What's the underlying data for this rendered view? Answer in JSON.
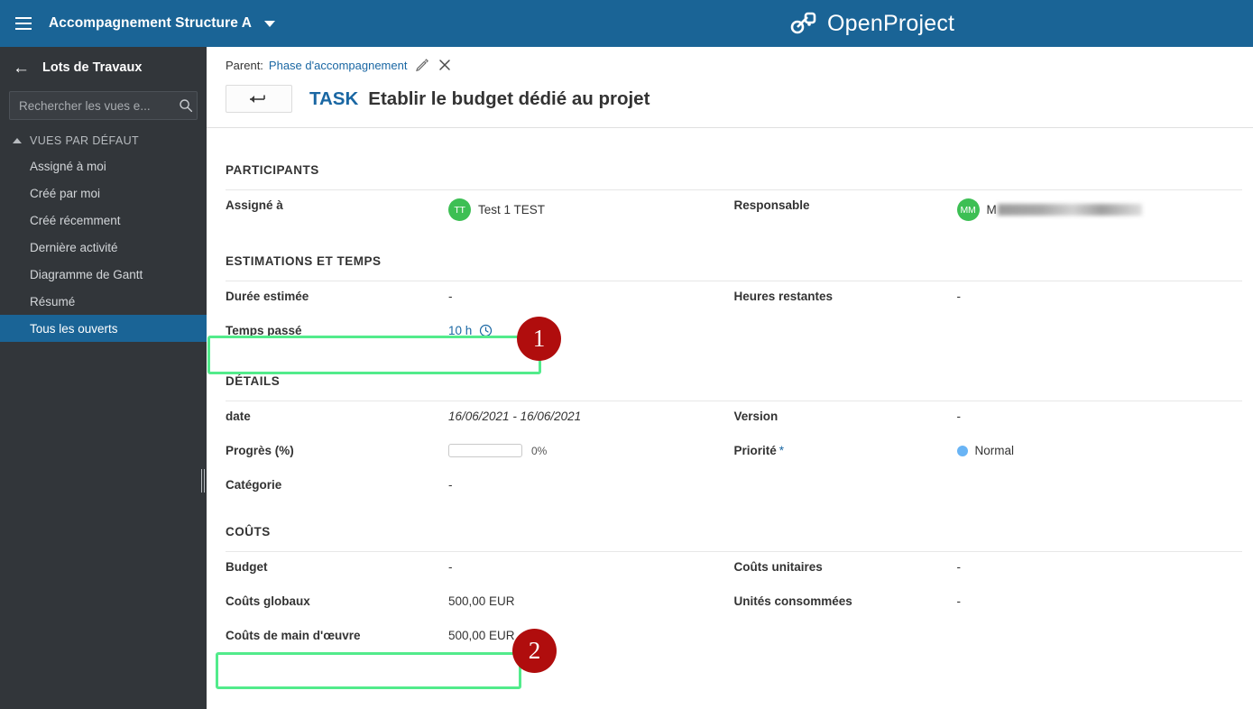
{
  "topbar": {
    "menu_icon": "hamburger-icon",
    "project_name": "Accompagnement Structure A",
    "dropdown_icon": "chevron-down-icon",
    "brand_name": "OpenProject",
    "brand_color": "#1a6496"
  },
  "sidebar": {
    "back_icon": "arrow-left-icon",
    "title": "Lots de Travaux",
    "search": {
      "value": "",
      "placeholder": "Rechercher les vues e...",
      "icon": "search-icon"
    },
    "group_label": "VUES PAR DÉFAUT",
    "group_caret_icon": "chevron-up-icon",
    "items": [
      {
        "label": "Assigné à moi",
        "active": false
      },
      {
        "label": "Créé par moi",
        "active": false
      },
      {
        "label": "Créé récemment",
        "active": false
      },
      {
        "label": "Dernière activité",
        "active": false
      },
      {
        "label": "Diagramme de Gantt",
        "active": false
      },
      {
        "label": "Résumé",
        "active": false
      },
      {
        "label": "Tous les ouverts",
        "active": true
      }
    ],
    "active_color": "#1a6496"
  },
  "header": {
    "parent_label": "Parent:",
    "parent_link": "Phase d'accompagnement",
    "edit_icon": "pencil-icon",
    "remove_icon": "close-icon",
    "back_button_icon": "arrow-left-long-icon",
    "work_package_type": "TASK",
    "work_package_subject": "Etablir le budget dédié au projet"
  },
  "sections": {
    "participants": {
      "title": "PARTICIPANTS",
      "left": [
        {
          "label": "Assigné à",
          "value": "Test 1 TEST",
          "avatar_initials": "TT",
          "avatar_color": "#3dbf54",
          "type": "user"
        }
      ],
      "right": [
        {
          "label": "Responsable",
          "value": "M",
          "avatar_initials": "MM",
          "avatar_color": "#3dbf54",
          "type": "user-redacted"
        }
      ]
    },
    "estimations": {
      "title": "ESTIMATIONS ET TEMPS",
      "left": [
        {
          "label": "Durée estimée",
          "value": "-",
          "type": "text"
        },
        {
          "label": "Temps passé",
          "value": "10 h",
          "type": "link-time",
          "icon": "clock-icon"
        }
      ],
      "right": [
        {
          "label": "Heures restantes",
          "value": "-",
          "type": "text"
        }
      ]
    },
    "details": {
      "title": "DÉTAILS",
      "left": [
        {
          "label": "date",
          "value": "16/06/2021 - 16/06/2021",
          "type": "date"
        },
        {
          "label": "Progrès (%)",
          "value": "0%",
          "progress": 0,
          "type": "progress"
        },
        {
          "label": "Catégorie",
          "value": "-",
          "type": "text"
        }
      ],
      "right": [
        {
          "label": "Version",
          "value": "-",
          "type": "text"
        },
        {
          "label": "Priorité",
          "value": "Normal",
          "required": true,
          "type": "priority",
          "dot_color": "#69b4f5"
        }
      ]
    },
    "costs": {
      "title": "COÛTS",
      "left": [
        {
          "label": "Budget",
          "value": "-",
          "type": "text"
        },
        {
          "label": "Coûts globaux",
          "value": "500,00 EUR",
          "type": "text"
        },
        {
          "label": "Coûts de main d'œuvre",
          "value": "500,00 EUR",
          "type": "text"
        }
      ],
      "right": [
        {
          "label": "Coûts unitaires",
          "value": "-",
          "type": "text"
        },
        {
          "label": "Unités consommées",
          "value": "-",
          "type": "text"
        }
      ]
    }
  },
  "annotations": {
    "highlight_color": "#52eb8b",
    "badge_color": "#b00d0d",
    "items": [
      {
        "number": "1",
        "target": "Temps passé"
      },
      {
        "number": "2",
        "target": "Coûts de main d'œuvre"
      }
    ]
  }
}
